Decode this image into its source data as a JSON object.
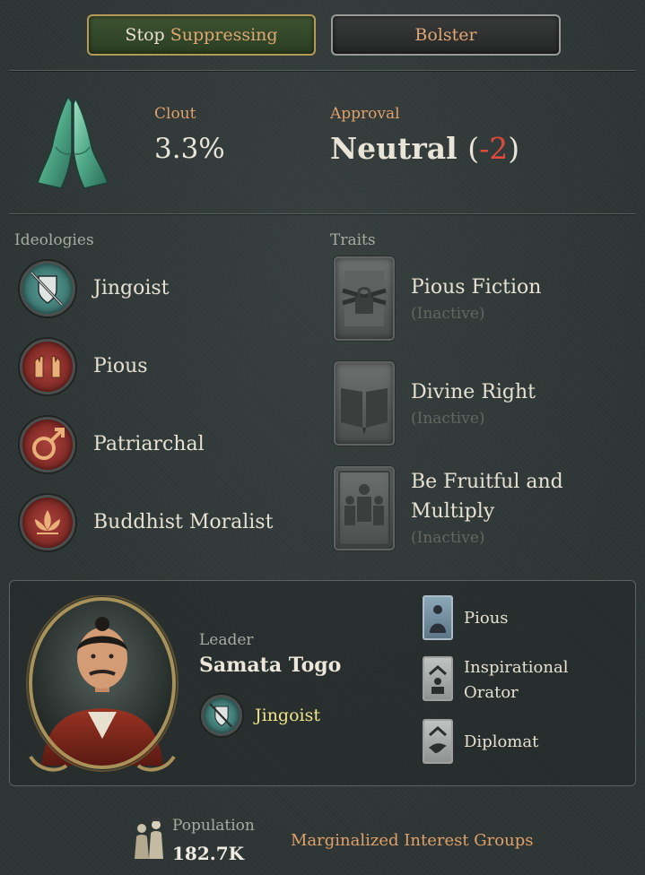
{
  "buttons": {
    "stop_word1": "Stop",
    "stop_word2": "Suppressing",
    "bolster": "Bolster"
  },
  "summary": {
    "icon": "praying-hands-icon",
    "clout_label": "Clout",
    "clout_value": "3.3%",
    "approval_label": "Approval",
    "approval_value": "Neutral",
    "approval_paren_open": "(",
    "approval_modifier": "-2",
    "approval_paren_close": ")",
    "approval_modifier_color": "#e04a3c"
  },
  "ideologies": {
    "heading": "Ideologies",
    "items": [
      {
        "label": "Jingoist",
        "icon": "sword-shield-icon",
        "color": "#2f6e6a"
      },
      {
        "label": "Pious",
        "icon": "hands-icon",
        "color": "#7a2422"
      },
      {
        "label": "Patriarchal",
        "icon": "male-symbol-icon",
        "color": "#7a2422"
      },
      {
        "label": "Buddhist Moralist",
        "icon": "lotus-icon",
        "color": "#7a2422"
      }
    ]
  },
  "traits": {
    "heading": "Traits",
    "items": [
      {
        "title": "Pious Fiction",
        "status": "(Inactive)",
        "icon": "chained-lock-icon"
      },
      {
        "title": "Divine Right",
        "status": "(Inactive)",
        "icon": "open-book-icon"
      },
      {
        "title_line1": "Be Fruitful and",
        "title_line2": "Multiply",
        "status": "(Inactive)",
        "icon": "family-icon"
      }
    ]
  },
  "leader": {
    "label": "Leader",
    "name": "Samata Togo",
    "ideology": "Jingoist",
    "ideology_icon": "sword-shield-icon",
    "portrait": "leader-portrait",
    "traits": [
      {
        "label": "Pious",
        "icon": "praying-figure-icon"
      },
      {
        "label_line1": "Inspirational",
        "label_line2": "Orator",
        "icon": "orator-icon"
      },
      {
        "label": "Diplomat",
        "icon": "dove-icon"
      }
    ]
  },
  "footer": {
    "population_label": "Population",
    "population_value": "182.7K",
    "population_icon": "people-icon",
    "marginalized": "Marginalized Interest Groups"
  }
}
